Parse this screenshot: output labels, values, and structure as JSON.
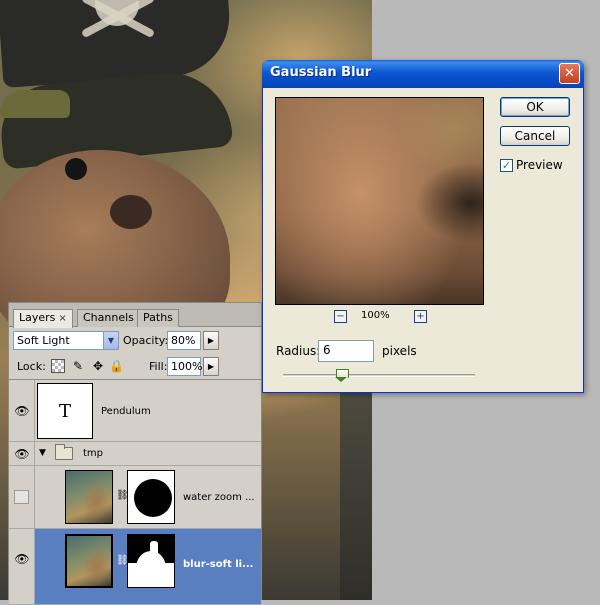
{
  "layers_panel": {
    "tabs": [
      {
        "label": "Layers",
        "close": "×"
      },
      {
        "label": "Channels"
      },
      {
        "label": "Paths"
      }
    ],
    "blend_mode": "Soft Light",
    "opacity_label": "Opacity:",
    "opacity_value": "80%",
    "lock_label": "Lock:",
    "fill_label": "Fill:",
    "fill_value": "100%",
    "layers": [
      {
        "name": "Pendulum",
        "thumb_text": "T",
        "visible": true
      },
      {
        "name": "tmp",
        "type": "group",
        "visible": true
      },
      {
        "name": "water zoom ...",
        "visible": false
      },
      {
        "name": "blur-soft li...",
        "visible": true,
        "selected": true
      }
    ],
    "icons": {
      "eye": "👁",
      "chain": "⛓",
      "group_arrow": "▼",
      "dropdown": "▼",
      "flyout": "▶",
      "lock_move": "✥",
      "lock_all": "🔒",
      "brush": "✎"
    }
  },
  "dialog": {
    "title": "Gaussian Blur",
    "close": "✕",
    "ok": "OK",
    "cancel": "Cancel",
    "preview_label": "Preview",
    "preview_checked": true,
    "check_mark": "✓",
    "zoom_level": "100%",
    "zoom_minus": "−",
    "zoom_plus": "+",
    "radius_label": "Radius:",
    "radius_value": "6",
    "unit": "pixels",
    "slider_fraction": 0.3
  }
}
